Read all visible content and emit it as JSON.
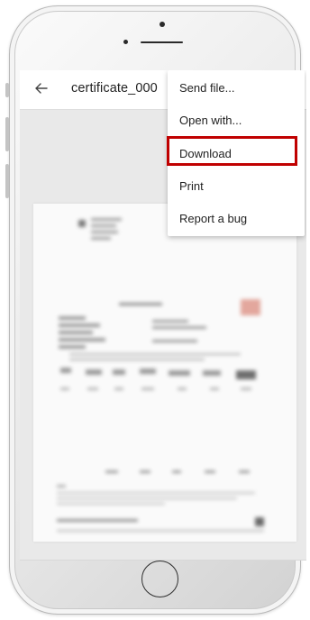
{
  "app_bar": {
    "title": "certificate_000"
  },
  "overflow_menu": {
    "items": [
      {
        "label": "Send file..."
      },
      {
        "label": "Open with..."
      },
      {
        "label": "Download"
      },
      {
        "label": "Print"
      },
      {
        "label": "Report a bug"
      }
    ],
    "highlighted_item": "Download",
    "highlight_color": "#c00000"
  },
  "icons": {
    "back": "arrow-left-icon"
  },
  "colors": {
    "app_bar_background": "#ffffff",
    "screen_background": "#e9e9e9",
    "menu_background": "#ffffff"
  }
}
